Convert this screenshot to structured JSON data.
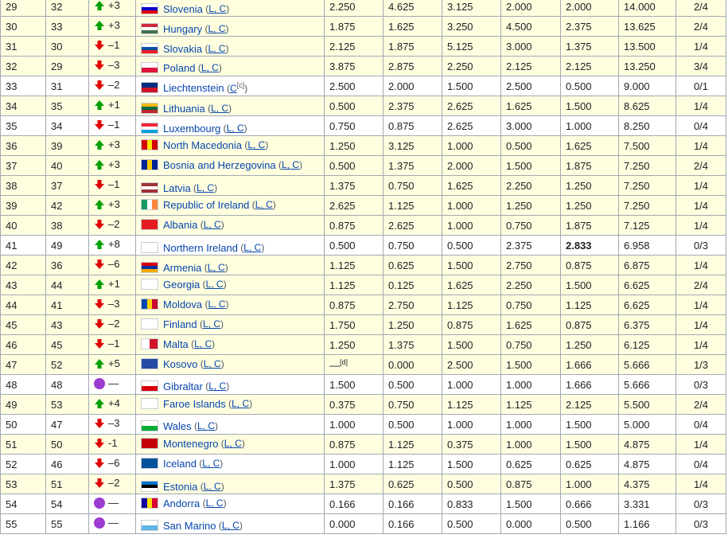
{
  "colors": {
    "up": "#00a000",
    "down": "#e00000",
    "same": "#9b3bcf",
    "link": "#0645ad",
    "row_highlight": "#ffffe0"
  },
  "rows": [
    {
      "rank": "29",
      "prev": "32",
      "dir": "up",
      "change": "+3",
      "country": "Slovenia",
      "note": "L, C",
      "flag": [
        "#ffffff",
        "#0000cc",
        "#e00000"
      ],
      "flagdir": "h",
      "v1": "2.250",
      "v2": "4.625",
      "v3": "3.125",
      "v4": "2.000",
      "v5": "2.000",
      "total": "14.000",
      "teams": "2/4",
      "hl": true
    },
    {
      "rank": "30",
      "prev": "33",
      "dir": "up",
      "change": "+3",
      "country": "Hungary",
      "note": "L, C",
      "flag": [
        "#cd2a3e",
        "#ffffff",
        "#436f4d"
      ],
      "flagdir": "h",
      "v1": "1.875",
      "v2": "1.625",
      "v3": "3.250",
      "v4": "4.500",
      "v5": "2.375",
      "total": "13.625",
      "teams": "2/4",
      "hl": true
    },
    {
      "rank": "31",
      "prev": "30",
      "dir": "down",
      "change": "–1",
      "country": "Slovakia",
      "note": "L, C",
      "flag": [
        "#ffffff",
        "#0b4ea2",
        "#ee1c25"
      ],
      "flagdir": "h",
      "v1": "2.125",
      "v2": "1.875",
      "v3": "5.125",
      "v4": "3.000",
      "v5": "1.375",
      "total": "13.500",
      "teams": "1/4",
      "hl": true
    },
    {
      "rank": "32",
      "prev": "29",
      "dir": "down",
      "change": "–3",
      "country": "Poland",
      "note": "L, C",
      "flag": [
        "#ffffff",
        "#dc143c"
      ],
      "flagdir": "h",
      "v1": "3.875",
      "v2": "2.875",
      "v3": "2.250",
      "v4": "2.125",
      "v5": "2.125",
      "total": "13.250",
      "teams": "3/4",
      "hl": true
    },
    {
      "rank": "33",
      "prev": "31",
      "dir": "down",
      "change": "–2",
      "country": "Liechtenstein",
      "note": "C",
      "noteref": "[c]",
      "flag": [
        "#002b7f",
        "#ce1126"
      ],
      "flagdir": "h",
      "v1": "2.500",
      "v2": "2.000",
      "v3": "1.500",
      "v4": "2.500",
      "v5": "0.500",
      "total": "9.000",
      "teams": "0/1",
      "hl": false
    },
    {
      "rank": "34",
      "prev": "35",
      "dir": "up",
      "change": "+1",
      "country": "Lithuania",
      "note": "L, C",
      "flag": [
        "#fdb913",
        "#006a44",
        "#c1272d"
      ],
      "flagdir": "h",
      "v1": "0.500",
      "v2": "2.375",
      "v3": "2.625",
      "v4": "1.625",
      "v5": "1.500",
      "total": "8.625",
      "teams": "1/4",
      "hl": true
    },
    {
      "rank": "35",
      "prev": "34",
      "dir": "down",
      "change": "–1",
      "country": "Luxembourg",
      "note": "L, C",
      "flag": [
        "#ed2939",
        "#ffffff",
        "#00a1de"
      ],
      "flagdir": "h",
      "v1": "0.750",
      "v2": "0.875",
      "v3": "2.625",
      "v4": "3.000",
      "v5": "1.000",
      "total": "8.250",
      "teams": "0/4",
      "hl": false
    },
    {
      "rank": "36",
      "prev": "39",
      "dir": "up",
      "change": "+3",
      "country": "North Macedonia",
      "note": "L, C",
      "flag": [
        "#d20000",
        "#ffe600",
        "#d20000"
      ],
      "flagdir": "v",
      "v1": "1.250",
      "v2": "3.125",
      "v3": "1.000",
      "v4": "0.500",
      "v5": "1.625",
      "total": "7.500",
      "teams": "1/4",
      "hl": true
    },
    {
      "rank": "37",
      "prev": "40",
      "dir": "up",
      "change": "+3",
      "country": "Bosnia and Herzegovina",
      "note": "L, C",
      "flag": [
        "#002395",
        "#fecb00",
        "#002395"
      ],
      "flagdir": "v",
      "v1": "0.500",
      "v2": "1.375",
      "v3": "2.000",
      "v4": "1.500",
      "v5": "1.875",
      "total": "7.250",
      "teams": "2/4",
      "hl": true
    },
    {
      "rank": "38",
      "prev": "37",
      "dir": "down",
      "change": "–1",
      "country": "Latvia",
      "note": "L, C",
      "flag": [
        "#9e3039",
        "#ffffff",
        "#9e3039"
      ],
      "flagdir": "h",
      "v1": "1.375",
      "v2": "0.750",
      "v3": "1.625",
      "v4": "2.250",
      "v5": "1.250",
      "total": "7.250",
      "teams": "1/4",
      "hl": true
    },
    {
      "rank": "39",
      "prev": "42",
      "dir": "up",
      "change": "+3",
      "country": "Republic of Ireland",
      "note": "L, C",
      "flag": [
        "#169b62",
        "#ffffff",
        "#ff883e"
      ],
      "flagdir": "v",
      "v1": "2.625",
      "v2": "1.125",
      "v3": "1.000",
      "v4": "1.250",
      "v5": "1.250",
      "total": "7.250",
      "teams": "1/4",
      "hl": true
    },
    {
      "rank": "40",
      "prev": "38",
      "dir": "down",
      "change": "–2",
      "country": "Albania",
      "note": "L, C",
      "flag": [
        "#e41e20"
      ],
      "flagdir": "h",
      "v1": "0.875",
      "v2": "2.625",
      "v3": "1.000",
      "v4": "0.750",
      "v5": "1.875",
      "total": "7.125",
      "teams": "1/4",
      "hl": true
    },
    {
      "rank": "41",
      "prev": "49",
      "dir": "up",
      "change": "+8",
      "country": "Northern Ireland",
      "note": "L, C",
      "flag": [
        "#ffffff",
        "#ffffff",
        "#ffffff"
      ],
      "flagdir": "h",
      "v1": "0.500",
      "v2": "0.750",
      "v3": "0.500",
      "v4": "2.375",
      "v5": "2.833",
      "bold5": true,
      "total": "6.958",
      "teams": "0/3",
      "hl": false
    },
    {
      "rank": "42",
      "prev": "36",
      "dir": "down",
      "change": "–6",
      "country": "Armenia",
      "note": "L, C",
      "flag": [
        "#d90012",
        "#0033a0",
        "#f2a800"
      ],
      "flagdir": "h",
      "v1": "1.125",
      "v2": "0.625",
      "v3": "1.500",
      "v4": "2.750",
      "v5": "0.875",
      "total": "6.875",
      "teams": "1/4",
      "hl": true
    },
    {
      "rank": "43",
      "prev": "44",
      "dir": "up",
      "change": "+1",
      "country": "Georgia",
      "note": "L, C",
      "flag": [
        "#ffffff"
      ],
      "flagdir": "h",
      "v1": "1.125",
      "v2": "0.125",
      "v3": "1.625",
      "v4": "2.250",
      "v5": "1.500",
      "total": "6.625",
      "teams": "2/4",
      "hl": true
    },
    {
      "rank": "44",
      "prev": "41",
      "dir": "down",
      "change": "–3",
      "country": "Moldova",
      "note": "L, C",
      "flag": [
        "#0046ae",
        "#ffd200",
        "#cc092f"
      ],
      "flagdir": "v",
      "v1": "0.875",
      "v2": "2.750",
      "v3": "1.125",
      "v4": "0.750",
      "v5": "1.125",
      "total": "6.625",
      "teams": "1/4",
      "hl": true
    },
    {
      "rank": "45",
      "prev": "43",
      "dir": "down",
      "change": "–2",
      "country": "Finland",
      "note": "L, C",
      "flag": [
        "#ffffff"
      ],
      "flagdir": "h",
      "v1": "1.750",
      "v2": "1.250",
      "v3": "0.875",
      "v4": "1.625",
      "v5": "0.875",
      "total": "6.375",
      "teams": "1/4",
      "hl": true
    },
    {
      "rank": "46",
      "prev": "45",
      "dir": "down",
      "change": "–1",
      "country": "Malta",
      "note": "L, C",
      "flag": [
        "#ffffff",
        "#cf142b"
      ],
      "flagdir": "v",
      "v1": "1.250",
      "v2": "1.375",
      "v3": "1.500",
      "v4": "0.750",
      "v5": "1.250",
      "total": "6.125",
      "teams": "1/4",
      "hl": true
    },
    {
      "rank": "47",
      "prev": "52",
      "dir": "up",
      "change": "+5",
      "country": "Kosovo",
      "note": "L, C",
      "flag": [
        "#244aa5"
      ],
      "flagdir": "h",
      "v1": "—",
      "v1ref": "[d]",
      "v2": "0.000",
      "v3": "2.500",
      "v4": "1.500",
      "v5": "1.666",
      "total": "5.666",
      "teams": "1/3",
      "hl": true
    },
    {
      "rank": "48",
      "prev": "48",
      "dir": "same",
      "change": "—",
      "country": "Gibraltar",
      "note": "L, C",
      "flag": [
        "#ffffff",
        "#da000c"
      ],
      "flagdir": "h",
      "v1": "1.500",
      "v2": "0.500",
      "v3": "1.000",
      "v4": "1.000",
      "v5": "1.666",
      "total": "5.666",
      "teams": "0/3",
      "hl": false
    },
    {
      "rank": "49",
      "prev": "53",
      "dir": "up",
      "change": "+4",
      "country": "Faroe Islands",
      "note": "L, C",
      "flag": [
        "#ffffff"
      ],
      "flagdir": "h",
      "v1": "0.375",
      "v2": "0.750",
      "v3": "1.125",
      "v4": "1.125",
      "v5": "2.125",
      "total": "5.500",
      "teams": "2/4",
      "hl": true
    },
    {
      "rank": "50",
      "prev": "47",
      "dir": "down",
      "change": "–3",
      "country": "Wales",
      "note": "L, C",
      "flag": [
        "#ffffff",
        "#00ad36"
      ],
      "flagdir": "h",
      "v1": "1.000",
      "v2": "0.500",
      "v3": "1.000",
      "v4": "1.000",
      "v5": "1.500",
      "total": "5.000",
      "teams": "0/4",
      "hl": false
    },
    {
      "rank": "51",
      "prev": "50",
      "dir": "down",
      "change": "-1",
      "country": "Montenegro",
      "note": "L, C",
      "flag": [
        "#c40308"
      ],
      "flagdir": "h",
      "v1": "0.875",
      "v2": "1.125",
      "v3": "0.375",
      "v4": "1.000",
      "v5": "1.500",
      "total": "4.875",
      "teams": "1/4",
      "hl": true
    },
    {
      "rank": "52",
      "prev": "46",
      "dir": "down",
      "change": "–6",
      "country": "Iceland",
      "note": "L, C",
      "flag": [
        "#02529c"
      ],
      "flagdir": "h",
      "v1": "1.000",
      "v2": "1.125",
      "v3": "1.500",
      "v4": "0.625",
      "v5": "0.625",
      "total": "4.875",
      "teams": "0/4",
      "hl": false
    },
    {
      "rank": "53",
      "prev": "51",
      "dir": "down",
      "change": "–2",
      "country": "Estonia",
      "note": "L, C",
      "flag": [
        "#0072ce",
        "#000000",
        "#ffffff"
      ],
      "flagdir": "h",
      "v1": "1.375",
      "v2": "0.625",
      "v3": "0.500",
      "v4": "0.875",
      "v5": "1.000",
      "total": "4.375",
      "teams": "1/4",
      "hl": true
    },
    {
      "rank": "54",
      "prev": "54",
      "dir": "same",
      "change": "—",
      "country": "Andorra",
      "note": "L, C",
      "flag": [
        "#10069f",
        "#fedf00",
        "#d50032"
      ],
      "flagdir": "v",
      "v1": "0.166",
      "v2": "0.166",
      "v3": "0.833",
      "v4": "1.500",
      "v5": "0.666",
      "total": "3.331",
      "teams": "0/3",
      "hl": false
    },
    {
      "rank": "55",
      "prev": "55",
      "dir": "same",
      "change": "—",
      "country": "San Marino",
      "note": "L, C",
      "flag": [
        "#ffffff",
        "#5eb6e4"
      ],
      "flagdir": "h",
      "v1": "0.000",
      "v2": "0.166",
      "v3": "0.500",
      "v4": "0.000",
      "v5": "0.500",
      "total": "1.166",
      "teams": "0/3",
      "hl": false
    }
  ]
}
